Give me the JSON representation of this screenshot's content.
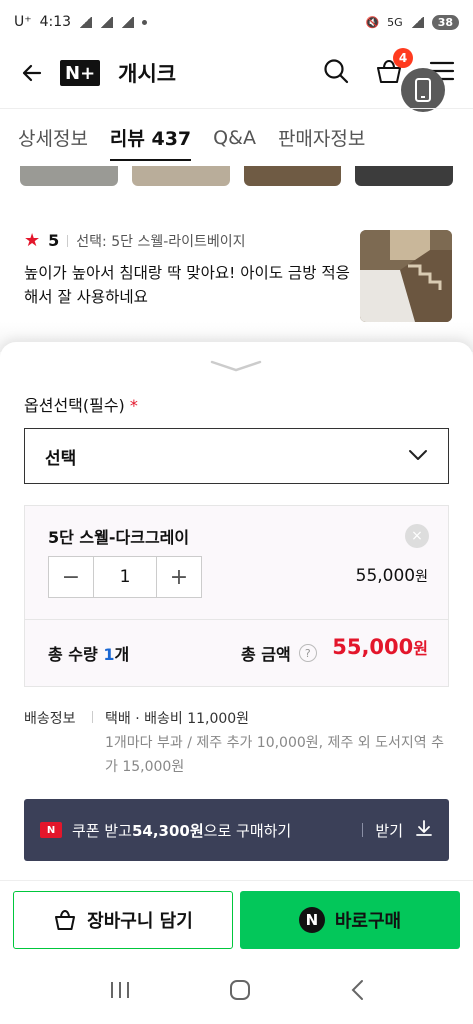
{
  "status_bar": {
    "carrier": "U⁺",
    "time": "4:13",
    "network": "5G",
    "battery": "38"
  },
  "header": {
    "logo": "N+",
    "brand": "개시크",
    "cart_count": "4"
  },
  "tabs": [
    {
      "label": "상세정보",
      "active": false
    },
    {
      "label": "리뷰 437",
      "active": true
    },
    {
      "label": "Q&A",
      "active": false
    },
    {
      "label": "판매자정보",
      "active": false
    }
  ],
  "review": {
    "star": "★",
    "score": "5",
    "option": "선택: 5단 스웰-라이트베이지",
    "text": "높이가 높아서 침대랑 딱 맞아요! 아이도 금방 적응해서 잘 사용하네요"
  },
  "options": {
    "label": "옵션선택(필수)",
    "required_mark": "*",
    "select_value": "선택"
  },
  "selected_item": {
    "name": "5단 스웰-다크그레이",
    "quantity": "1",
    "price": "55,000",
    "price_unit": "원",
    "remove": "×",
    "minus": "−",
    "plus": "+"
  },
  "totals": {
    "qty_label": "총 수량",
    "qty_value": "1",
    "qty_unit": "개",
    "amount_label": "총 금액",
    "help": "?",
    "amount": "55,000",
    "amount_unit": "원"
  },
  "shipping": {
    "label": "배송정보",
    "main": "택배 · 배송비 11,000원",
    "sub": "1개마다 부과 / 제주 추가 10,000원, 제주 외 도서지역 추가 15,000원"
  },
  "coupon": {
    "icon": "N",
    "prefix": "쿠폰 받고 ",
    "amount": "54,300원",
    "suffix": "으로 구매하기",
    "download": "받기"
  },
  "actions": {
    "cart": "장바구니 담기",
    "buy_icon": "N",
    "buy": "바로구매"
  },
  "colors": {
    "naver_green": "#03c75a",
    "price_red": "#e3162b",
    "coupon_bg": "#3b4058"
  }
}
